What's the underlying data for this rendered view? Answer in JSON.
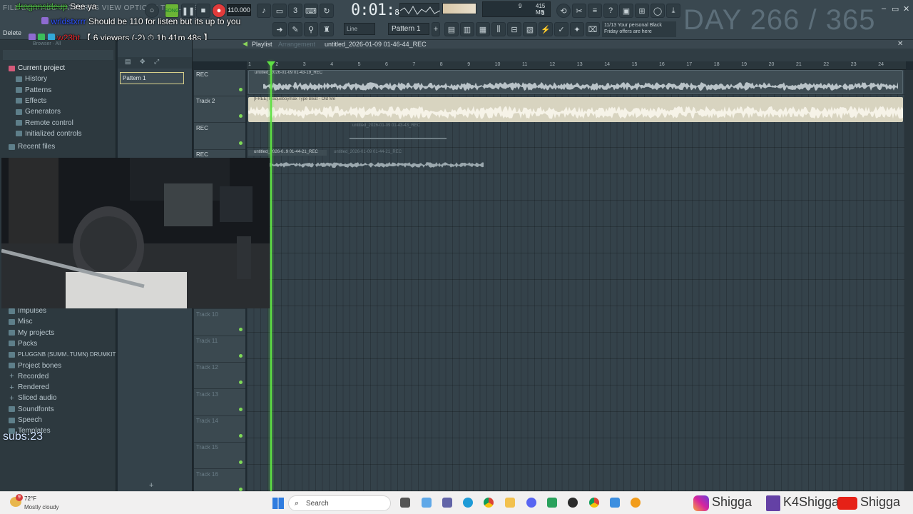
{
  "topbar": {
    "menu": "FILE EDIT ADD PATTERNS VIEW OPTIONS TOOLS HELP",
    "tempo": "110.000",
    "time_main": "0:01",
    "time_sub": "84",
    "cpu_mem": "415 MB",
    "cpu_poly": "3",
    "cpu_top": "9",
    "day_counter": "DAY 266 / 365",
    "promo_line1": "11/13  Your personal Black",
    "promo_line2": "Friday offers are here",
    "pattern_select": "Pattern 1",
    "line_select": "Line",
    "delete_label": "Delete"
  },
  "chat": [
    {
      "user": "dragonsideup",
      "text": "See ya",
      "user_color": "#54c84c"
    },
    {
      "user": "wrldstxrrr",
      "text": "Should be 110 for listen but its up to you",
      "user_color": "#2d52ff"
    },
    {
      "user": "w23bt",
      "text": "",
      "user_color": "#e0262b"
    }
  ],
  "viewers": "【 6 viewers (-2) ⏱ 1h 41m 48s 】",
  "browser": {
    "header": "Browser · All",
    "items_top": [
      "Current project",
      "History",
      "Patterns",
      "Effects",
      "Generators",
      "Remote control",
      "Initialized controls",
      "Recent files"
    ],
    "items_bottom": [
      "Impulses",
      "Misc",
      "My projects",
      "Packs",
      "PLUGGNB (SUMM..TUMN) DRUMKIT",
      "Project bones",
      "Recorded",
      "Rendered",
      "Sliced audio",
      "Soundfonts",
      "Speech",
      "Templates"
    ]
  },
  "pattern_list": {
    "item": "Pattern 1"
  },
  "playlist": {
    "title": "Playlist",
    "sub": "Arrangement",
    "project": "untitled_2026-01-09 01-46-44_REC",
    "ruler": [
      "1",
      "2",
      "3",
      "4",
      "5",
      "6",
      "7",
      "8",
      "9",
      "10",
      "11",
      "12",
      "13",
      "14",
      "15",
      "16",
      "17",
      "18",
      "19",
      "20",
      "21",
      "22",
      "23",
      "24"
    ],
    "tracks": [
      "REC",
      "Track 2",
      "REC",
      "REC",
      "",
      "",
      "",
      "",
      "",
      "Track 10",
      "Track 11",
      "Track 12",
      "Track 13",
      "Track 14",
      "Track 15",
      "Track 16"
    ],
    "clips": [
      {
        "label": "untitled_2026-01-09 01-43-19_REC"
      },
      {
        "label": "[FREE] Plaqueboymax Type Beat - Old Me"
      },
      {
        "label": "untitled_2026-01-09 01-43-43_REC"
      },
      {
        "label": "untitled_2026-0..9 01-44-21_REC"
      },
      {
        "label": "untitled_2026-01-09 01-44-21_REC"
      }
    ]
  },
  "subs": "subs:23",
  "taskbar": {
    "weather_temp": "72°F",
    "weather_desc": "Mostly cloudy",
    "search_placeholder": "Search",
    "notif_count": "9",
    "social_ig": "Shigga",
    "social_twitch": "K4Shigga",
    "social_yt": "Shigga"
  },
  "colors": {
    "accent_green": "#5ee043",
    "audio_clip": "#d8d4c0",
    "clip_bg": "#3e4c53"
  }
}
